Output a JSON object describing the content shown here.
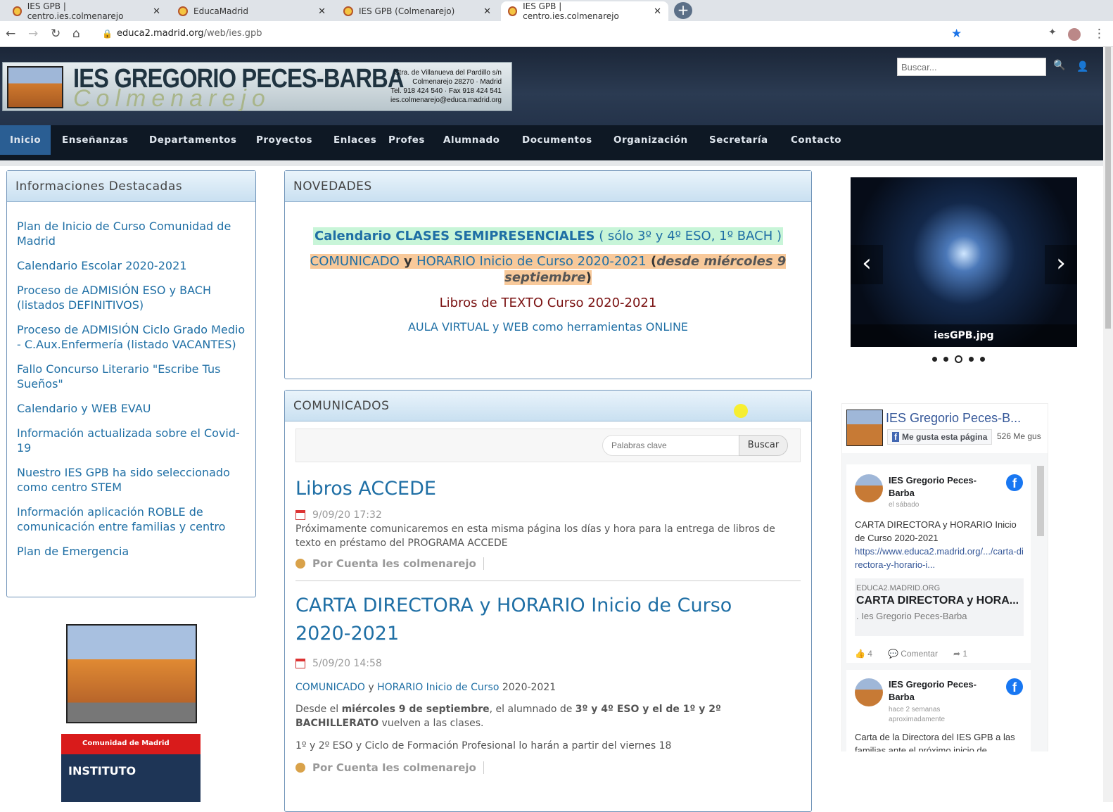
{
  "browser": {
    "tabs": [
      {
        "title": "IES GPB | centro.ies.colmenarejo"
      },
      {
        "title": "EducaMadrid"
      },
      {
        "title": "IES GPB (Colmenarejo)"
      },
      {
        "title": "IES GPB | centro.ies.colmenarejo"
      }
    ],
    "url_host": "educa2.madrid.org",
    "url_path": "/web/ies.gpb"
  },
  "header": {
    "school": "IES GREGORIO PECES-BARBA",
    "town": "Colmenarejo",
    "address": [
      "Ctra. de Villanueva del Pardillo s/n",
      "Colmenarejo 28270 · Madrid",
      "Tel. 918 424 540 · Fax 918 424 541",
      "ies.colmenarejo@educa.madrid.org"
    ],
    "search_placeholder": "Buscar..."
  },
  "nav": [
    "Inicio",
    "Enseñanzas",
    "Departamentos",
    "Proyectos",
    "Enlaces",
    "Profes",
    "Alumnado",
    "Documentos",
    "Organización",
    "Secretaría",
    "Contacto"
  ],
  "left": {
    "title": "Informaciones Destacadas",
    "links": [
      "Plan de Inicio de Curso Comunidad de Madrid",
      "Calendario Escolar 2020-2021",
      "Proceso de ADMISIÓN ESO y BACH (listados DEFINITIVOS)",
      "Proceso de ADMISIÓN Ciclo Grado Medio - C.Aux.Enfermería (listado VACANTES)",
      "Fallo Concurso Literario \"Escribe Tus Sueños\"",
      "Calendario y WEB EVAU",
      "Información actualizada sobre el Covid-19",
      "Nuestro IES GPB ha sido seleccionado como centro STEM",
      "Información aplicación ROBLE de comunicación entre familias y centro",
      "Plan de Emergencia"
    ],
    "banner_top": "Comunidad de Madrid",
    "banner_bottom": "INSTITUTO"
  },
  "novedades": {
    "title": "NOVEDADES",
    "l1a": "Calendario ",
    "l1b": "CLASES SEMIPRESENCIALES",
    "l1c": " ( sólo 3º y 4º ESO, 1º BACH )",
    "l2a": "COMUNICADO",
    "l2b": " y ",
    "l2c": "HORARIO Inicio de Curso 2020-2021",
    "l2d": " (",
    "l2e": "desde miércoles 9 septiembre",
    "l2f": ")",
    "l3": "Libros de TEXTO Curso 2020-2021",
    "l4": "AULA VIRTUAL y WEB como herramientas ONLINE"
  },
  "comunicados": {
    "title": "COMUNICADOS",
    "kw_placeholder": "Palabras clave",
    "search_btn": "Buscar",
    "posts": [
      {
        "title": "Libros ACCEDE",
        "date": "9/09/20 17:32",
        "body": "Próximamente comunicaremos en esta misma página los días y hora para la entrega de libros de texto en préstamo del PROGRAMA ACCEDE",
        "author": "Por Cuenta Ies colmenarejo"
      },
      {
        "title": "CARTA DIRECTORA y HORARIO Inicio de Curso 2020-2021",
        "date": "5/09/20 14:58",
        "link1": "COMUNICADO",
        "link_y": " y ",
        "link2": "HORARIO Inicio de Curso",
        "link_year": " 2020-2021",
        "p1a": "Desde el ",
        "p1b": "miércoles 9 de septiembre",
        "p1c": ", el alumnado de ",
        "p1d": "3º y 4º ESO y el de 1º y 2º BACHILLERATO",
        "p1e": " vuelven a las clases.",
        "p2": "1º y 2º ESO y Ciclo de Formación Profesional lo harán a partir del viernes 18",
        "author": "Por Cuenta Ies colmenarejo"
      }
    ]
  },
  "carousel": {
    "caption": "iesGPB.jpg",
    "slides": 5,
    "active": 3
  },
  "facebook": {
    "page": "IES Gregorio Peces-B...",
    "like_btn": "Me gusta esta página",
    "likes": "526 Me gus",
    "posts": [
      {
        "name": "IES Gregorio Peces-Barba",
        "time": "el sábado",
        "text": "CARTA DIRECTORA y HORARIO Inicio de Curso 2020-2021",
        "link": "https://www.educa2.madrid.org/.../carta-directora-y-horario-i...",
        "domain": "EDUCA2.MADRID.ORG",
        "card_title": "CARTA DIRECTORA y HORA...",
        "card_sub": ". Ies Gregorio Peces-Barba",
        "likes": "4",
        "comment": "Comentar",
        "shares": "1"
      },
      {
        "name": "IES Gregorio Peces-Barba",
        "time": "hace 2 semanas aproximadamente",
        "text": "Carta de la Directora del IES GPB a las familias ante el próximo inicio de"
      }
    ]
  }
}
